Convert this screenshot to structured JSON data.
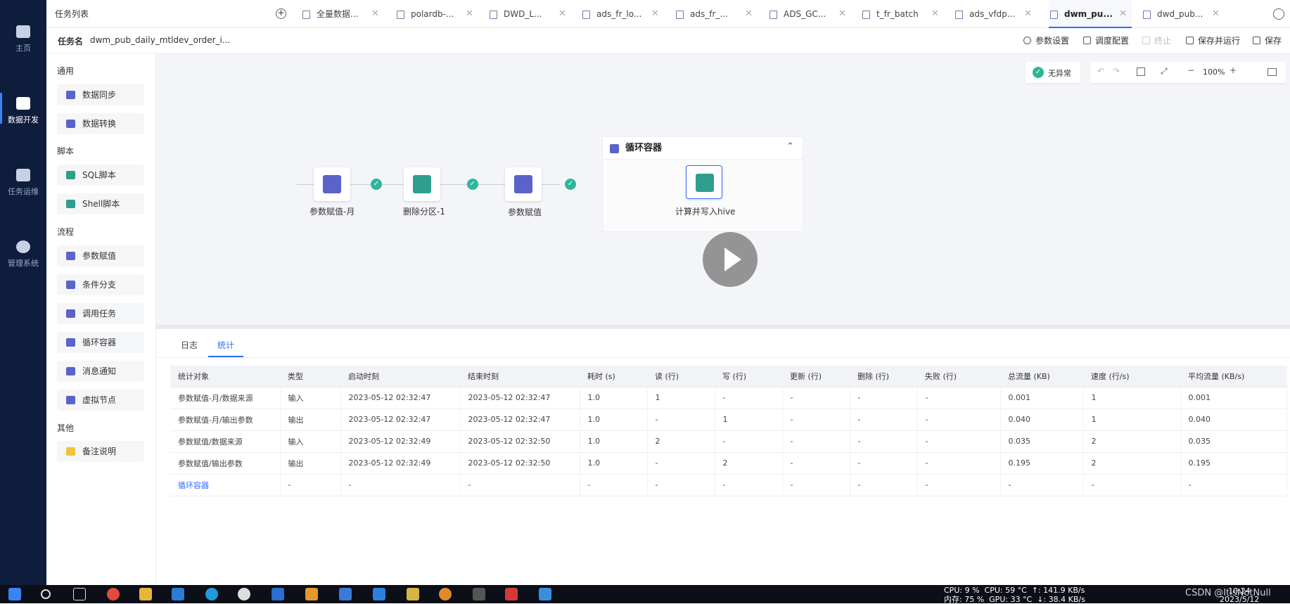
{
  "nav": [
    {
      "label": "主页",
      "icon": "home-icon"
    },
    {
      "label": "数据开发",
      "icon": "data-dev-icon",
      "active": true
    },
    {
      "label": "任务运维",
      "icon": "ops-icon"
    },
    {
      "label": "管理系统",
      "icon": "gear-icon"
    }
  ],
  "tabbar": {
    "title": "任务列表",
    "tabs": [
      "全量数据...",
      "polardb-...",
      "DWD_L...",
      "ads_fr_lo...",
      "ads_fr_...",
      "ADS_GC...",
      "t_fr_batch",
      "ads_vfdp...",
      "dwm_pu...",
      "dwd_pub..."
    ],
    "active_index": 8
  },
  "task": {
    "name_label": "任务名",
    "name": "dwm_pub_daily_mtldev_order_i...",
    "btn_params": "参数设置",
    "btn_schedule": "调度配置",
    "btn_stop": "终止",
    "btn_save_run": "保存并运行",
    "btn_save": "保存"
  },
  "palette": {
    "groups": [
      {
        "title": "通用",
        "items": [
          "数据同步",
          "数据转换"
        ]
      },
      {
        "title": "脚本",
        "items": [
          "SQL脚本",
          "Shell脚本"
        ]
      },
      {
        "title": "流程",
        "items": [
          "参数赋值",
          "条件分支",
          "调用任务",
          "循环容器",
          "消息通知",
          "虚拟节点"
        ]
      },
      {
        "title": "其他",
        "items": [
          "备注说明"
        ]
      }
    ]
  },
  "canvas": {
    "status": "无异常",
    "zoom": "100%",
    "nodes": [
      "参数赋值-月",
      "删除分区-1",
      "参数赋值",
      "计算并写入hive"
    ],
    "loop_title": "循环容器"
  },
  "bottom": {
    "tabs": [
      "日志",
      "统计"
    ],
    "active_tab": 1,
    "headers": [
      "统计对象",
      "类型",
      "启动时刻",
      "结束时刻",
      "耗时 (s)",
      "读 (行)",
      "写 (行)",
      "更新 (行)",
      "删除 (行)",
      "失败 (行)",
      "总流量 (KB)",
      "速度 (行/s)",
      "平均流量 (KB/s)"
    ],
    "rows": [
      [
        "参数赋值-月/数据来源",
        "输入",
        "2023-05-12 02:32:47",
        "2023-05-12 02:32:47",
        "1.0",
        "1",
        "-",
        "-",
        "-",
        "-",
        "0.001",
        "1",
        "0.001"
      ],
      [
        "参数赋值-月/输出参数",
        "输出",
        "2023-05-12 02:32:47",
        "2023-05-12 02:32:47",
        "1.0",
        "-",
        "1",
        "-",
        "-",
        "-",
        "0.040",
        "1",
        "0.040"
      ],
      [
        "参数赋值/数据来源",
        "输入",
        "2023-05-12 02:32:49",
        "2023-05-12 02:32:50",
        "1.0",
        "2",
        "-",
        "-",
        "-",
        "-",
        "0.035",
        "2",
        "0.035"
      ],
      [
        "参数赋值/输出参数",
        "输出",
        "2023-05-12 02:32:49",
        "2023-05-12 02:32:50",
        "1.0",
        "-",
        "2",
        "-",
        "-",
        "-",
        "0.195",
        "2",
        "0.195"
      ],
      [
        "循环容器",
        "-",
        "-",
        "-",
        "-",
        "-",
        "-",
        "-",
        "-",
        "-",
        "-",
        "-",
        "-"
      ]
    ]
  },
  "tray": {
    "cpu": "CPU: 9 %",
    "cpu_temp": "CPU: 59 °C",
    "net_up": "↑: 141.9 KB/s",
    "mem": "内存: 75 %",
    "gpu": "GPU: 33 °C",
    "net_down": "↓: 38.4 KB/s",
    "time": "10:24",
    "date": "2023/5/12"
  },
  "watermark": "CSDN @ItIsNotNull"
}
